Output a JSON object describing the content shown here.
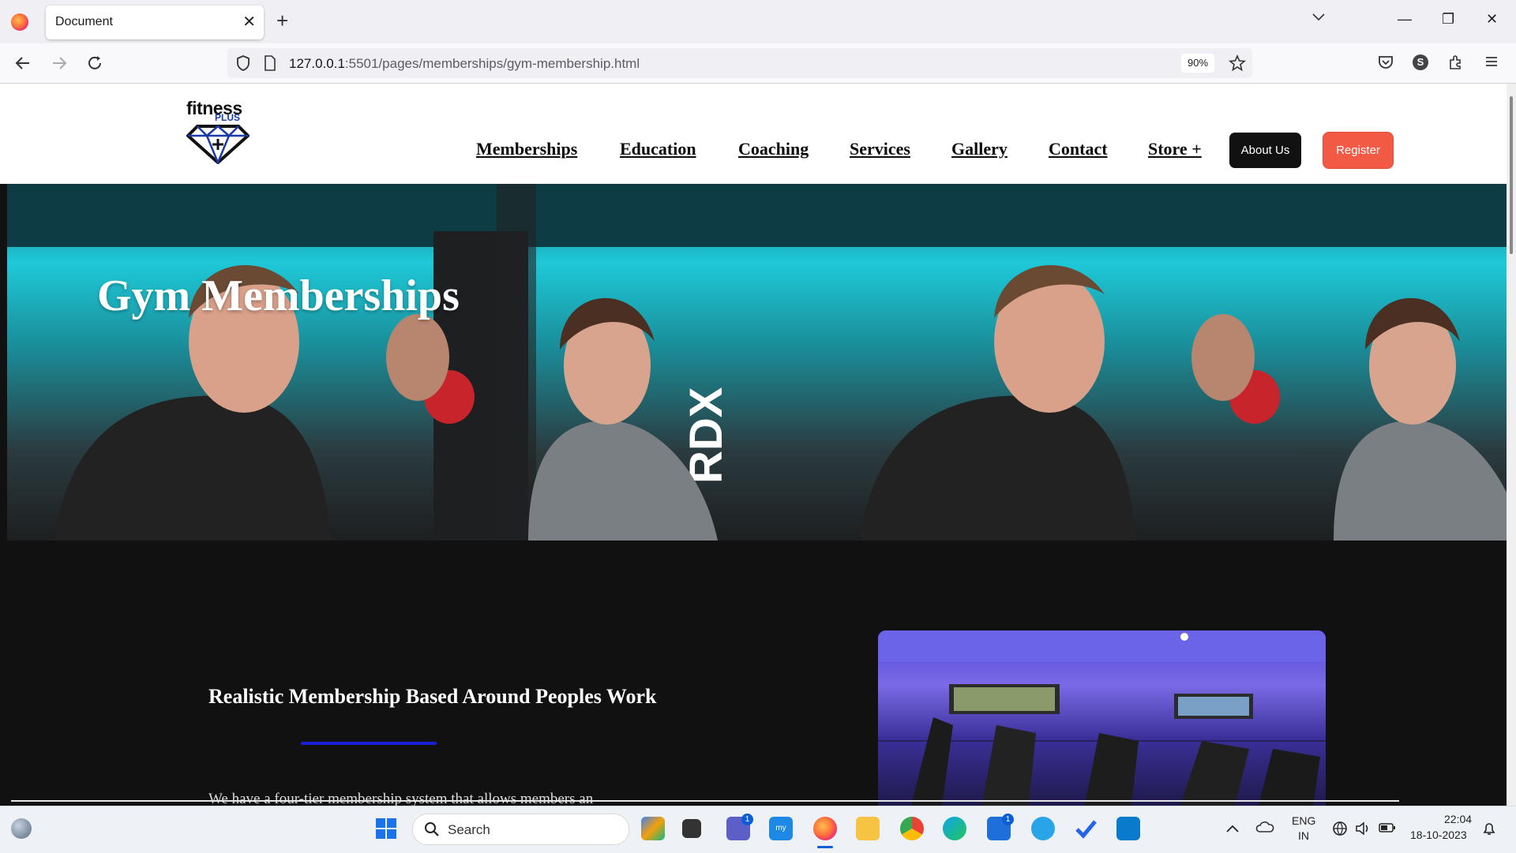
{
  "browser": {
    "tab_title": "Document",
    "url_host": "127.0.0.1",
    "url_rest": ":5501/pages/memberships/gym-membership.html",
    "zoom": "90%"
  },
  "site": {
    "logo_text": "fitness",
    "logo_sub": "PLUS",
    "nav": [
      "Memberships",
      "Education",
      "Coaching",
      "Services",
      "Gallery",
      "Contact",
      "Store +"
    ],
    "about_label": "About Us",
    "register_label": "Register",
    "hero_title": "Gym Memberships",
    "section_title": "Realistic Membership Based Around Peoples Work",
    "body_text": "We have a four-tier membership system that allows members an"
  },
  "taskbar": {
    "search_label": "Search",
    "lang_line1": "ENG",
    "lang_line2": "IN",
    "time": "22:04",
    "date": "18-10-2023",
    "badge_teams": "1",
    "badge_store": "1"
  }
}
